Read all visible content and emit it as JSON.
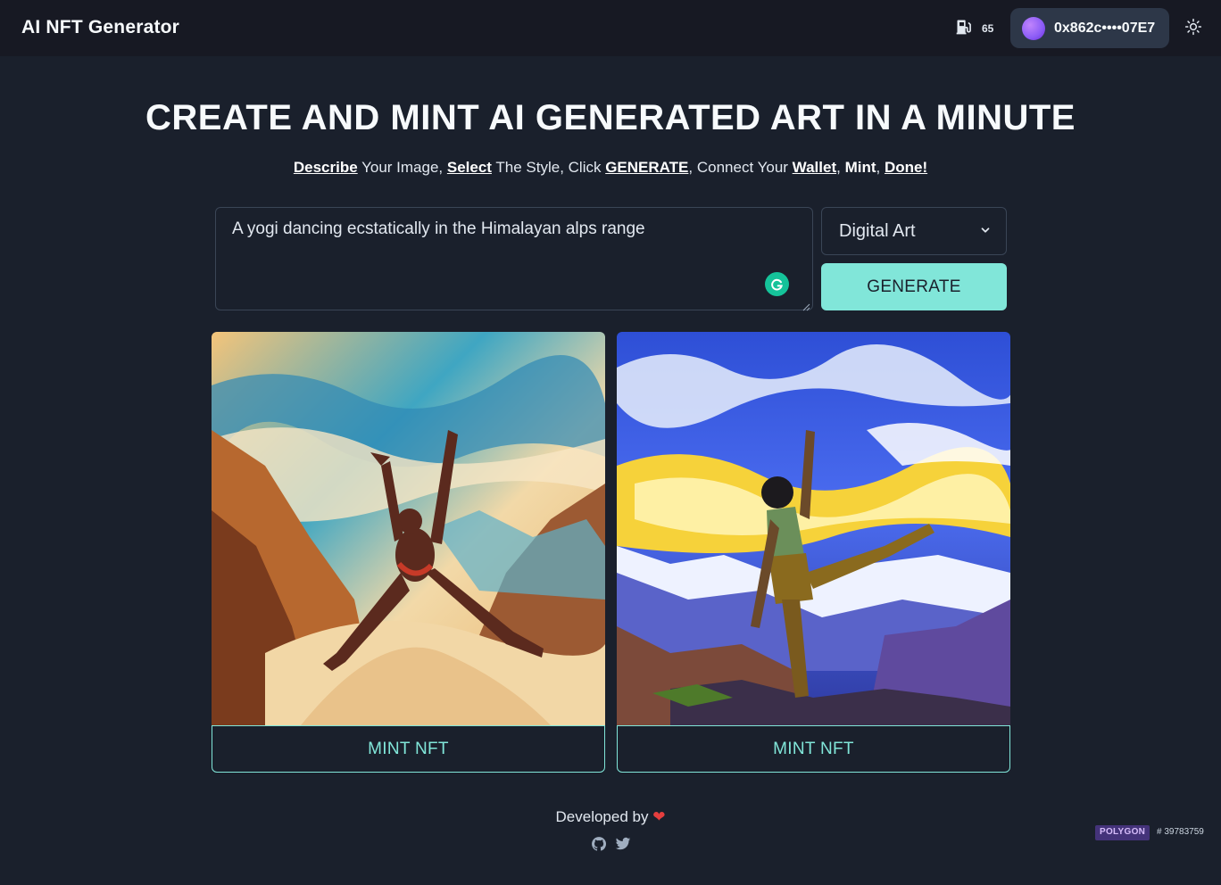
{
  "header": {
    "title": "AI NFT Generator",
    "gas_value": "65",
    "gas_icon": "gas-pump-icon",
    "wallet_address": "0x862c••••07E7",
    "theme_icon": "sun-icon"
  },
  "hero": {
    "title": "CREATE AND MINT AI GENERATED ART IN A MINUTE",
    "steps": [
      {
        "kw": "Describe",
        "text": " Your Image, "
      },
      {
        "kw": "Select",
        "text": " The Style, Click "
      },
      {
        "kw": "GENERATE",
        "text": ", Connect Your "
      },
      {
        "kw": "Wallet",
        "text": ", "
      },
      {
        "kw": "Mint",
        "text": ", "
      },
      {
        "kw": "Done!",
        "text": ""
      }
    ]
  },
  "form": {
    "prompt_value": "A yogi dancing ecstatically in the Himalayan alps range",
    "style_selected": "Digital Art",
    "generate_label": "GENERATE"
  },
  "results": [
    {
      "image_label": "Yogi dancing with raised arms, warm orange and teal painting",
      "mint_label": "MINT NFT"
    },
    {
      "image_label": "Yogi balancing on one leg, blue sky and yellow clouds painting",
      "mint_label": "MINT NFT"
    }
  ],
  "footer": {
    "developed_by": "Developed by",
    "heart": "❤",
    "network": "POLYGON",
    "block": "# 39783759"
  },
  "colors": {
    "background": "#1a202c",
    "topbar": "#171923",
    "accent": "#81e6d9",
    "wallet_bg": "#2d3748"
  }
}
